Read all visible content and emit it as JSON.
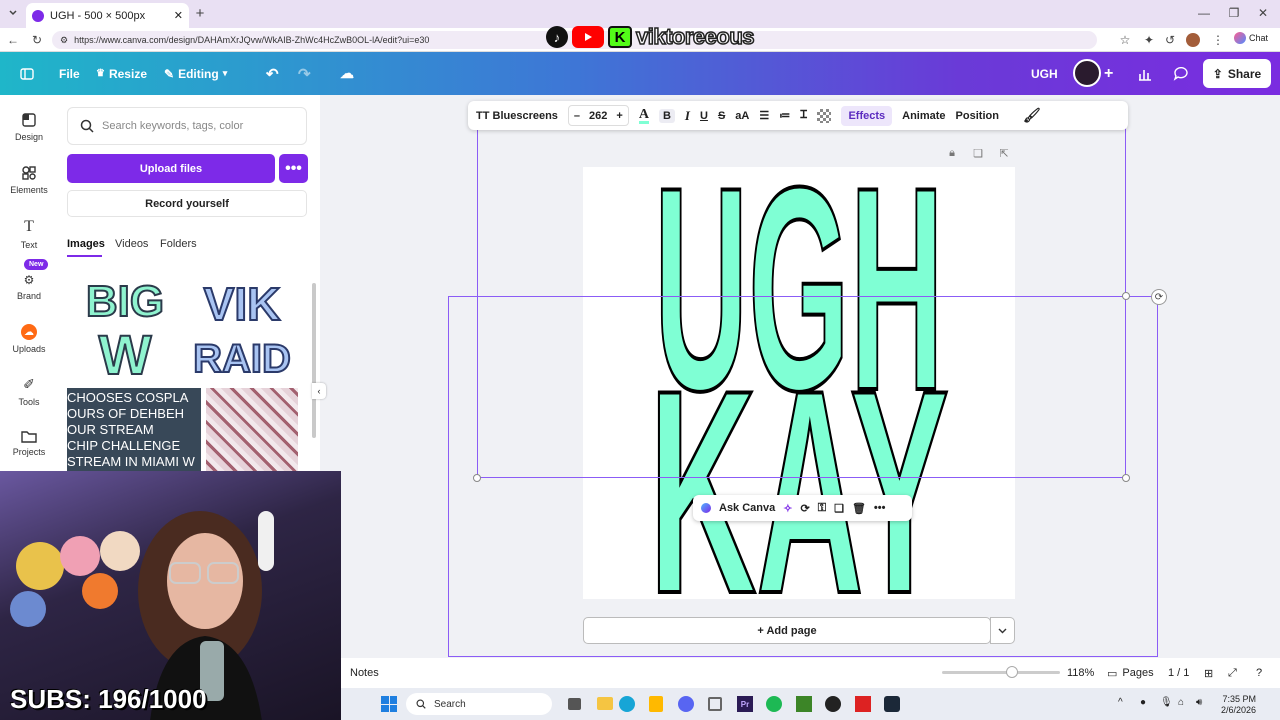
{
  "browser": {
    "tab_title": "UGH - 500 × 500px",
    "url": "https://www.canva.com/design/DAHAmXrJQvw/WkAIB-ZhWc4HcZwB0OL-lA/edit?ui=e30",
    "chat_label": "Chat"
  },
  "overlay": {
    "handle": "viktoreeous",
    "subs": "SUBS: 196/1000"
  },
  "header": {
    "file": "File",
    "resize": "Resize",
    "editing": "Editing",
    "design_title": "UGH",
    "share": "Share"
  },
  "rail": {
    "items": [
      "Design",
      "Elements",
      "Text",
      "Brand",
      "Uploads",
      "Tools",
      "Projects"
    ],
    "new_badge": "New"
  },
  "panel": {
    "search_placeholder": "Search keywords, tags, color",
    "upload_files": "Upload files",
    "record_yourself": "Record yourself",
    "tabs": [
      "Images",
      "Videos",
      "Folders"
    ],
    "thumb_big": [
      "BIG",
      "W"
    ],
    "thumb_vik": [
      "VIK",
      "RAID"
    ],
    "thumb_text_lines": [
      " CHOOSES COSPLA",
      "OURS OF DEHBEH",
      "OUR STREAM",
      "CHIP CHALLENGE",
      "STREAM IN MIAMI W"
    ]
  },
  "toolbar": {
    "font": "TT Bluescreens",
    "minus": "–",
    "size": "262",
    "plus": "+",
    "effects": "Effects",
    "animate": "Animate",
    "position": "Position"
  },
  "canvas": {
    "line1": "UGH",
    "line2": "KAY",
    "text_fill": "#7fffd4"
  },
  "ask_canva": "Ask Canva",
  "add_page": "+ Add page",
  "footer": {
    "notes": "Notes",
    "zoom": "118%",
    "pages": "Pages",
    "page_count": "1 / 1"
  },
  "taskbar": {
    "search": "Search",
    "time": "7:35 PM",
    "date": "2/6/2026"
  }
}
